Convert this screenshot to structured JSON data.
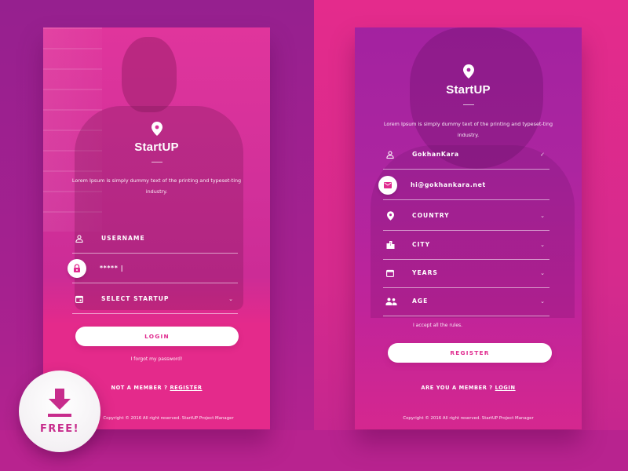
{
  "colors": {
    "accent": "#e02b8f",
    "bg_left": "#96208f",
    "bg_right": "#e42b8c",
    "badge_text": "#c72c8c"
  },
  "login_panel": {
    "brand_icon": "map-pin-icon",
    "brand_name": "StartUP",
    "description": "Lorem Ipsum is simply dummy text of the printing and typeset-ting industry.",
    "fields": [
      {
        "icon": "user-icon",
        "placeholder": "USERNAME",
        "value": ""
      },
      {
        "icon": "lock-icon",
        "placeholder": "",
        "value": "***** |"
      },
      {
        "icon": "calendar-icon",
        "label": "SELECT STARTUP",
        "trailing_icon": "chevron-down-icon"
      }
    ],
    "login_button": "LOGIN",
    "forgot_password": "I forgot my password!",
    "member_prompt": "NOT A MEMBER ?",
    "register_link": "REGISTER",
    "copyright": "Copyright © 2016 All right reserved. StartUP Project Manager"
  },
  "register_panel": {
    "brand_icon": "map-pin-icon",
    "brand_name": "StartUP",
    "description": "Lorem Ipsum is simply dummy text of the printing and typeset-ting industry.",
    "fields": [
      {
        "icon": "user-icon",
        "value": "GokhanKara",
        "trailing_icon": "check-icon"
      },
      {
        "icon": "mail-icon",
        "value": "hi@gokhankara.net"
      },
      {
        "icon": "location-icon",
        "label": "COUNTRY",
        "trailing_icon": "chevron-down-icon"
      },
      {
        "icon": "city-icon",
        "label": "CITY",
        "trailing_icon": "chevron-down-icon"
      },
      {
        "icon": "calendar-icon",
        "label": "YEARS",
        "trailing_icon": "chevron-down-icon"
      },
      {
        "icon": "people-icon",
        "label": "AGE",
        "trailing_icon": "chevron-down-icon"
      }
    ],
    "accept_rules": "I accept all the rules.",
    "register_button": "REGISTER",
    "member_prompt": "ARE YOU A MEMBER ?",
    "login_link": "LOGIN",
    "copyright": "Copyright © 2016 All right reserved. StartUP Project Manager"
  },
  "badge": {
    "icon": "download-icon",
    "label": "FREE!"
  }
}
